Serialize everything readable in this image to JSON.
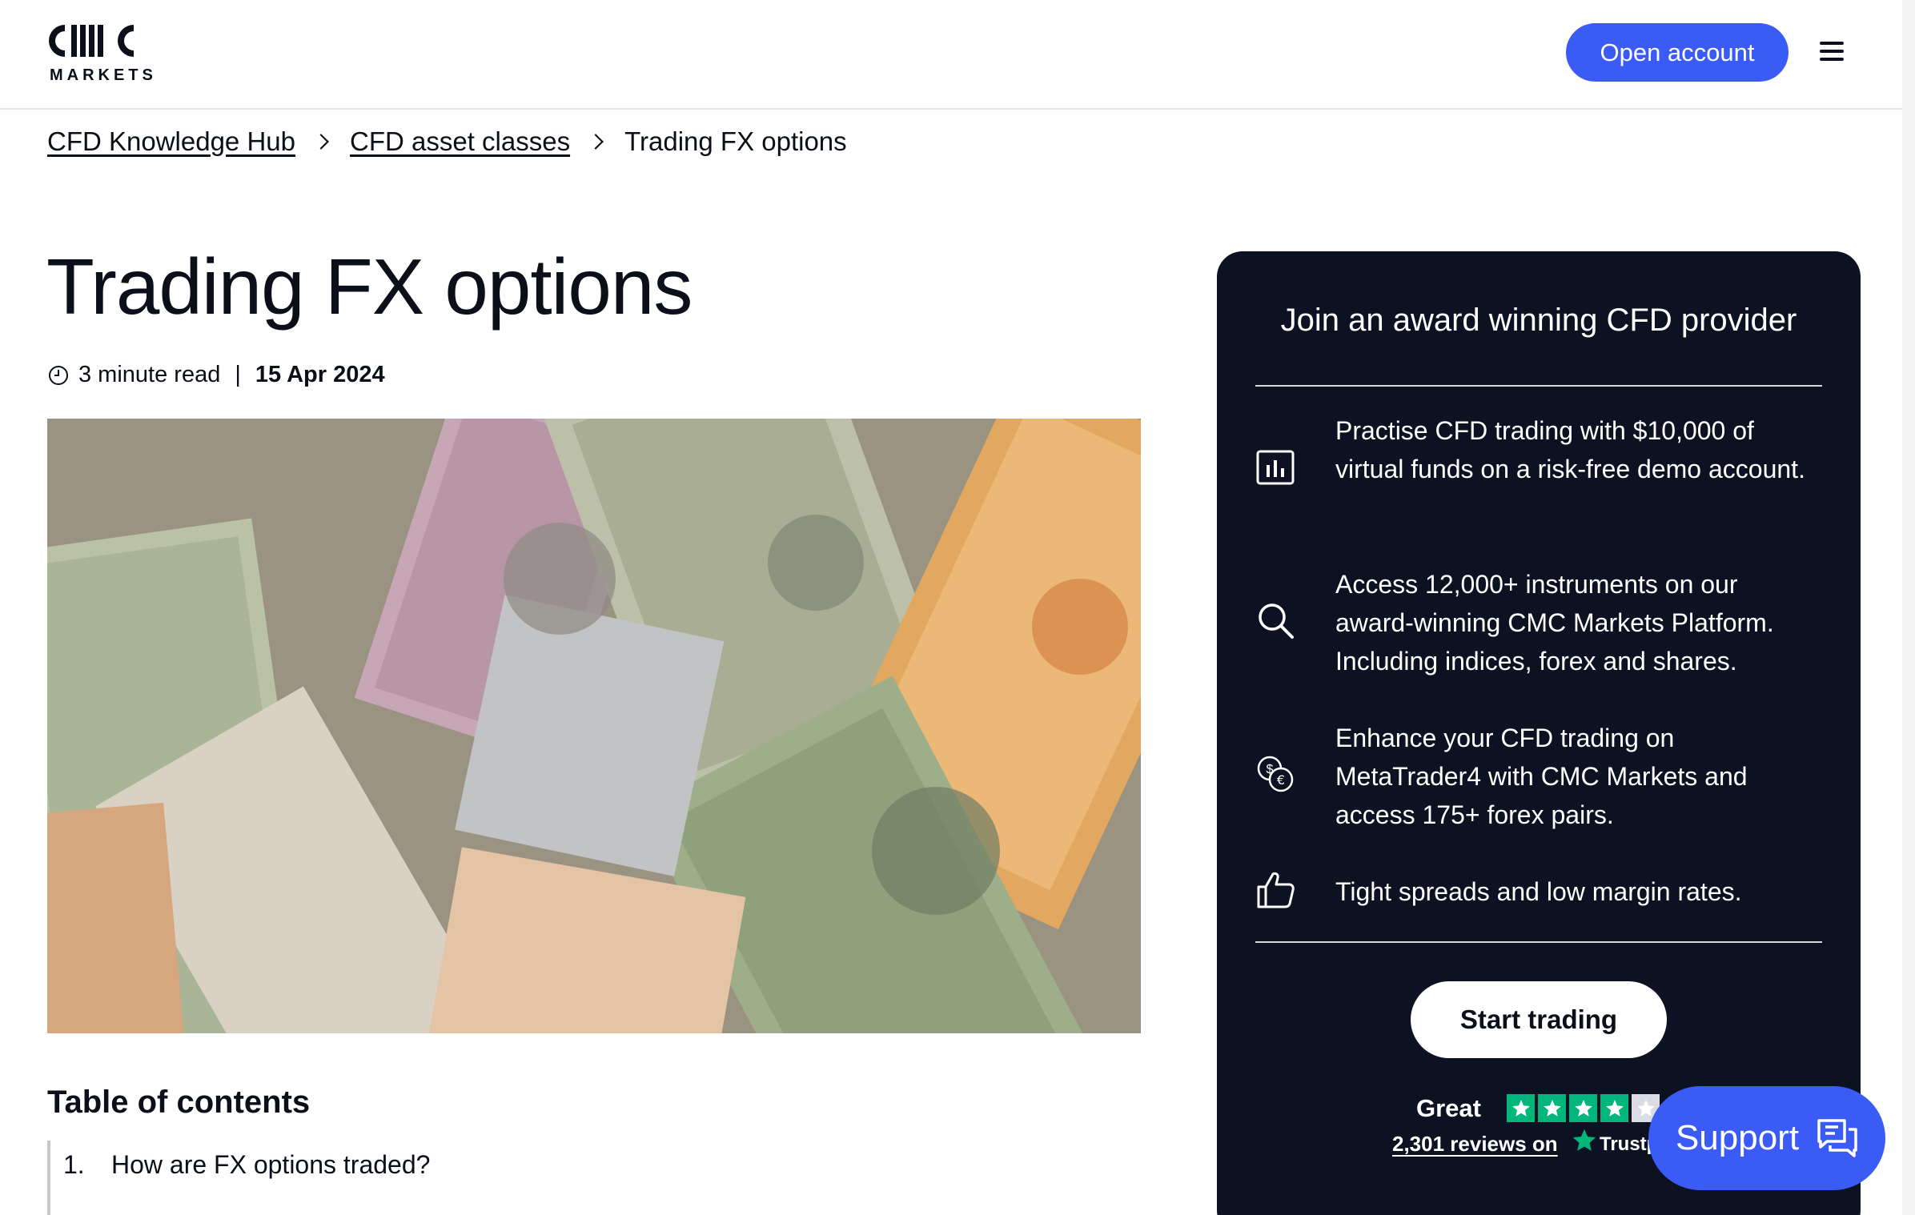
{
  "header": {
    "logo_text": "CMC",
    "logo_sub": "MARKETS",
    "open_account_label": "Open account"
  },
  "breadcrumb": {
    "items": [
      {
        "label": "CFD Knowledge Hub"
      },
      {
        "label": "CFD asset classes"
      },
      {
        "label": "Trading FX options"
      }
    ]
  },
  "article": {
    "title": "Trading FX options",
    "read_time": "3 minute read",
    "separator": "|",
    "date": "15 Apr 2024",
    "hero_image": "currency-banknotes-photo"
  },
  "toc": {
    "title": "Table of contents",
    "items": [
      {
        "num": "1.",
        "label": "How are FX options traded?"
      }
    ]
  },
  "panel": {
    "title": "Join an award winning CFD provider",
    "features": [
      {
        "icon": "bar-chart-icon",
        "text": "Practise CFD trading with $10,000 of virtual funds on a risk-free demo account."
      },
      {
        "icon": "search-icon",
        "text": "Access 12,000+ instruments on our award-winning CMC Markets Platform. Including indices, forex and shares."
      },
      {
        "icon": "currency-coins-icon",
        "text": "Enhance your CFD trading on MetaTrader4 with CMC Markets and access 175+ forex pairs."
      },
      {
        "icon": "thumbs-up-icon",
        "text": "Tight spreads and low margin rates."
      }
    ],
    "cta_label": "Start trading",
    "trust": {
      "rating_label": "Great",
      "stars_filled": 4,
      "stars_total": 5,
      "reviews_link": "2,301 reviews on",
      "provider": "Trustp"
    }
  },
  "support": {
    "label": "Support"
  },
  "colors": {
    "accent": "#3b5bf6",
    "panel_bg": "#0c1221",
    "trustpilot_green": "#00b67a"
  }
}
